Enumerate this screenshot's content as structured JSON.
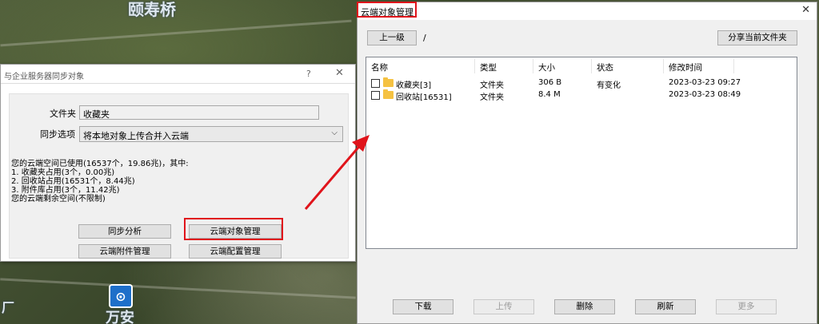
{
  "map": {
    "top_label": "颐寿桥",
    "bottom_label": "万安",
    "left_label": "厂"
  },
  "sync_dialog": {
    "title": "与企业服务器同步对象",
    "help_glyph": "?",
    "close_glyph": "✕",
    "folder_label": "文件夹",
    "folder_value": "收藏夹",
    "sync_option_label": "同步选项",
    "sync_option_value": "将本地对象上传合并入云端",
    "usage_lines": [
      "您的云端空间已使用(16537个，19.86兆)，其中:",
      "1. 收藏夹占用(3个，0.00兆)",
      "2. 回收站占用(16531个，8.44兆)",
      "3. 附件库占用(3个，11.42兆)",
      "您的云端剩余空间(不限制)"
    ],
    "buttons": {
      "sync_analyze": "同步分析",
      "cloud_objects": "云端对象管理",
      "cloud_attachments": "云端附件管理",
      "cloud_config": "云端配置管理"
    }
  },
  "cloud_dialog": {
    "title": "云端对象管理",
    "close_glyph": "✕",
    "up_button": "上一级",
    "path": "/",
    "share_button": "分享当前文件夹",
    "columns": [
      "名称",
      "类型",
      "大小",
      "状态",
      "修改时间"
    ],
    "rows": [
      {
        "name": "收藏夹[3]",
        "type": "文件夹",
        "size": "306 B",
        "status": "有变化",
        "modified": "2023-03-23 09:27"
      },
      {
        "name": "回收站[16531]",
        "type": "文件夹",
        "size": "8.4 M",
        "status": "",
        "modified": "2023-03-23 08:49"
      }
    ],
    "bottom_buttons": {
      "download": "下载",
      "upload": "上传",
      "delete": "删除",
      "refresh": "刷新",
      "more": "更多"
    }
  },
  "colors": {
    "highlight_red": "#e0141b",
    "folder_yellow": "#f5c242"
  }
}
